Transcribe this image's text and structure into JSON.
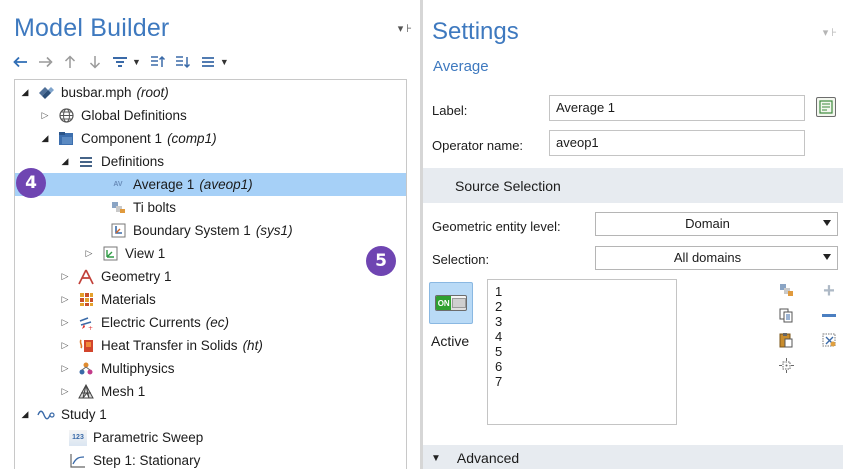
{
  "model_builder": {
    "title": "Model Builder",
    "pin": "▾ ⊦",
    "toolbar": [
      "back-arrow",
      "forward-arrow",
      "move-up",
      "move-down",
      "show-dropdown",
      "expand-all",
      "collapse-all",
      "view-dropdown"
    ],
    "tree": [
      {
        "label": "busbar.mph",
        "tag": "(root)",
        "icon": "root-icon"
      },
      {
        "label": "Global Definitions",
        "tag": "",
        "icon": "globe-icon"
      },
      {
        "label": "Component 1",
        "tag": "(comp1)",
        "icon": "component-icon"
      },
      {
        "label": "Definitions",
        "tag": "",
        "icon": "definitions-icon"
      },
      {
        "label": "Average 1",
        "tag": "(aveop1)",
        "icon": "average-icon",
        "icon_text": "AV"
      },
      {
        "label": "Ti bolts",
        "tag": "",
        "icon": "selection-icon"
      },
      {
        "label": "Boundary System 1",
        "tag": "(sys1)",
        "icon": "coordinate-system-icon"
      },
      {
        "label": "View 1",
        "tag": "",
        "icon": "view-icon"
      },
      {
        "label": "Geometry 1",
        "tag": "",
        "icon": "geometry-icon"
      },
      {
        "label": "Materials",
        "tag": "",
        "icon": "materials-icon"
      },
      {
        "label": "Electric Currents",
        "tag": "(ec)",
        "icon": "electric-currents-icon"
      },
      {
        "label": "Heat Transfer in Solids",
        "tag": "(ht)",
        "icon": "heat-transfer-icon"
      },
      {
        "label": "Multiphysics",
        "tag": "",
        "icon": "multiphysics-icon"
      },
      {
        "label": "Mesh 1",
        "tag": "",
        "icon": "mesh-icon"
      },
      {
        "label": "Study 1",
        "tag": "",
        "icon": "study-icon"
      },
      {
        "label": "Parametric Sweep",
        "tag": "",
        "icon": "parametric-sweep-icon",
        "icon_text": "123"
      },
      {
        "label": "Step 1: Stationary",
        "tag": "",
        "icon": "stationary-step-icon"
      }
    ]
  },
  "settings": {
    "title": "Settings",
    "pin": "▾ ⊦",
    "subtitle": "Average",
    "label_field": {
      "label": "Label:",
      "value": "Average 1"
    },
    "operator_field": {
      "label": "Operator name:",
      "value": "aveop1"
    },
    "source_selection": {
      "header": "Source Selection",
      "entity_level": {
        "label": "Geometric entity level:",
        "value": "Domain"
      },
      "selection": {
        "label": "Selection:",
        "value": "All domains"
      },
      "items": [
        "1",
        "2",
        "3",
        "4",
        "5",
        "6",
        "7"
      ],
      "active_label": "Active",
      "toggle_text": "ON"
    },
    "advanced": {
      "header": "Advanced"
    }
  },
  "callouts": {
    "left": "4",
    "right": "5"
  },
  "colors": {
    "accent": "#3e79bf",
    "selected_row": "#a6d0f7",
    "callout": "#6f45b2",
    "section": "#e7ebf0"
  }
}
